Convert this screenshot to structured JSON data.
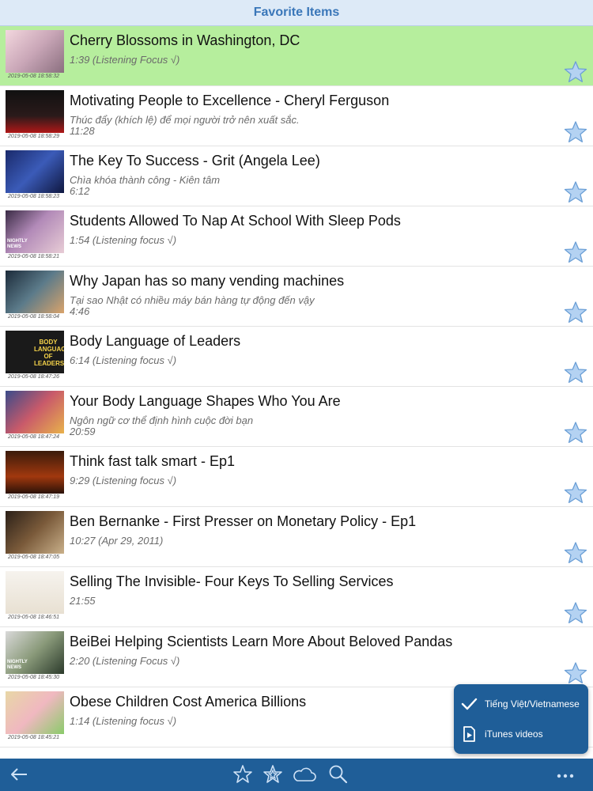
{
  "app": {
    "title": "Favorite Items"
  },
  "items": [
    {
      "title": "Cherry Blossoms in Washington, DC",
      "subtitle": "1:39 (Listening Focus √)",
      "subtitle2": "",
      "stamp": "2019-05-08 18:58:32",
      "thumb_text": "",
      "selected": true
    },
    {
      "title": "Motivating People to Excellence - Cheryl Ferguson",
      "subtitle": "Thúc đẩy (khích lệ) để mọi người trở nên xuất sắc.",
      "subtitle2": "11:28",
      "stamp": "2019-05-08 18:58:29",
      "thumb_text": ""
    },
    {
      "title": "The Key To Success - Grit (Angela Lee)",
      "subtitle": "Chìa khóa thành công - Kiên tâm",
      "subtitle2": "6:12",
      "stamp": "2019-05-08 18:58:23",
      "thumb_text": ""
    },
    {
      "title": "Students Allowed To Nap At School With Sleep Pods",
      "subtitle": "1:54 (Listening focus √)",
      "subtitle2": "",
      "stamp": "2019-05-08 18:58:21",
      "thumb_text": "NIGHTLY NEWS"
    },
    {
      "title": "Why Japan has so many vending machines",
      "subtitle": "Tại sao Nhật có nhiều máy bán hàng tự động đến vậy",
      "subtitle2": "4:46",
      "stamp": "2019-05-08 18:58:04",
      "thumb_text": ""
    },
    {
      "title": "Body Language of Leaders",
      "subtitle": "6:14 (Listening focus √)",
      "subtitle2": "",
      "stamp": "2019-05-08 18:47:26",
      "thumb_text": "BODY LANGUAGE OF LEADERS"
    },
    {
      "title": "Your Body Language Shapes Who You Are",
      "subtitle": "Ngôn ngữ cơ thể định hình cuộc đời bạn",
      "subtitle2": "20:59",
      "stamp": "2019-05-08 18:47:24",
      "thumb_text": ""
    },
    {
      "title": "Think fast talk smart - Ep1",
      "subtitle": "9:29 (Listening focus √)",
      "subtitle2": "",
      "stamp": "2019-05-08 18:47:19",
      "thumb_text": ""
    },
    {
      "title": "Ben Bernanke - First Presser on Monetary Policy - Ep1",
      "subtitle": "10:27 (Apr 29, 2011)",
      "subtitle2": "",
      "stamp": "2019-05-08 18:47:05",
      "thumb_text": ""
    },
    {
      "title": "Selling The Invisible- Four Keys To Selling Services",
      "subtitle": "21:55",
      "subtitle2": "",
      "stamp": "2019-05-08 18:46:51",
      "thumb_text": ""
    },
    {
      "title": "BeiBei Helping Scientists Learn More About Beloved Pandas",
      "subtitle": "2:20 (Listening Focus √)",
      "subtitle2": "",
      "stamp": "2019-05-08 18:45:30",
      "thumb_text": "NIGHTLY NEWS"
    },
    {
      "title": "Obese Children Cost America Billions",
      "subtitle": "1:14 (Listening focus √)",
      "subtitle2": "",
      "stamp": "2019-05-08 18:45:21",
      "thumb_text": ""
    }
  ],
  "popover": {
    "items": [
      {
        "label": "Tiếng Việt/Vietnamese",
        "icon": "checkmark-icon"
      },
      {
        "label": "iTunes videos",
        "icon": "video-file-icon"
      }
    ]
  },
  "toolbar": {
    "buttons": [
      "back-arrow-icon",
      "star-outline-icon",
      "star-burst-icon",
      "cloud-icon",
      "search-icon",
      "more-icon"
    ]
  },
  "colors": {
    "accent": "#1f5e98",
    "header_bg": "#ddeaf7",
    "header_text": "#3a77b9",
    "selected_row": "#b6ee9d",
    "star_fill": "#b4d2f2",
    "star_stroke": "#6b9fd6"
  }
}
